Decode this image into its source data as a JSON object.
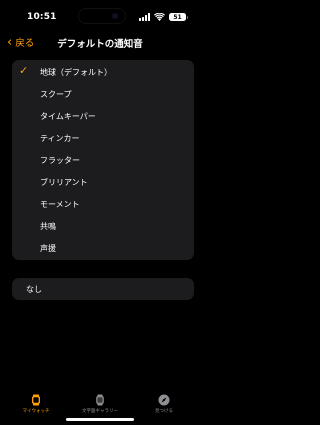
{
  "status": {
    "time": "10:51",
    "battery": "51"
  },
  "nav": {
    "back_label": "戻る",
    "title": "デフォルトの通知音"
  },
  "sounds": [
    {
      "label": "地球（デフォルト）",
      "selected": true
    },
    {
      "label": "スクープ",
      "selected": false
    },
    {
      "label": "タイムキーパー",
      "selected": false
    },
    {
      "label": "ティンカー",
      "selected": false
    },
    {
      "label": "フラッター",
      "selected": false
    },
    {
      "label": "ブリリアント",
      "selected": false
    },
    {
      "label": "モーメント",
      "selected": false
    },
    {
      "label": "共鳴",
      "selected": false
    },
    {
      "label": "声援",
      "selected": false
    }
  ],
  "none_option": {
    "label": "なし",
    "selected": false
  },
  "tabs": [
    {
      "label": "マイウォッチ",
      "icon": "watch-icon",
      "active": true
    },
    {
      "label": "文字盤ギャラリー",
      "icon": "watch-face-gallery-icon",
      "active": false
    },
    {
      "label": "見つける",
      "icon": "compass-icon",
      "active": false
    }
  ],
  "colors": {
    "accent": "#ff9f0a",
    "background": "#000000",
    "group_bg": "#1c1c1e",
    "inactive": "#8e8e93"
  }
}
